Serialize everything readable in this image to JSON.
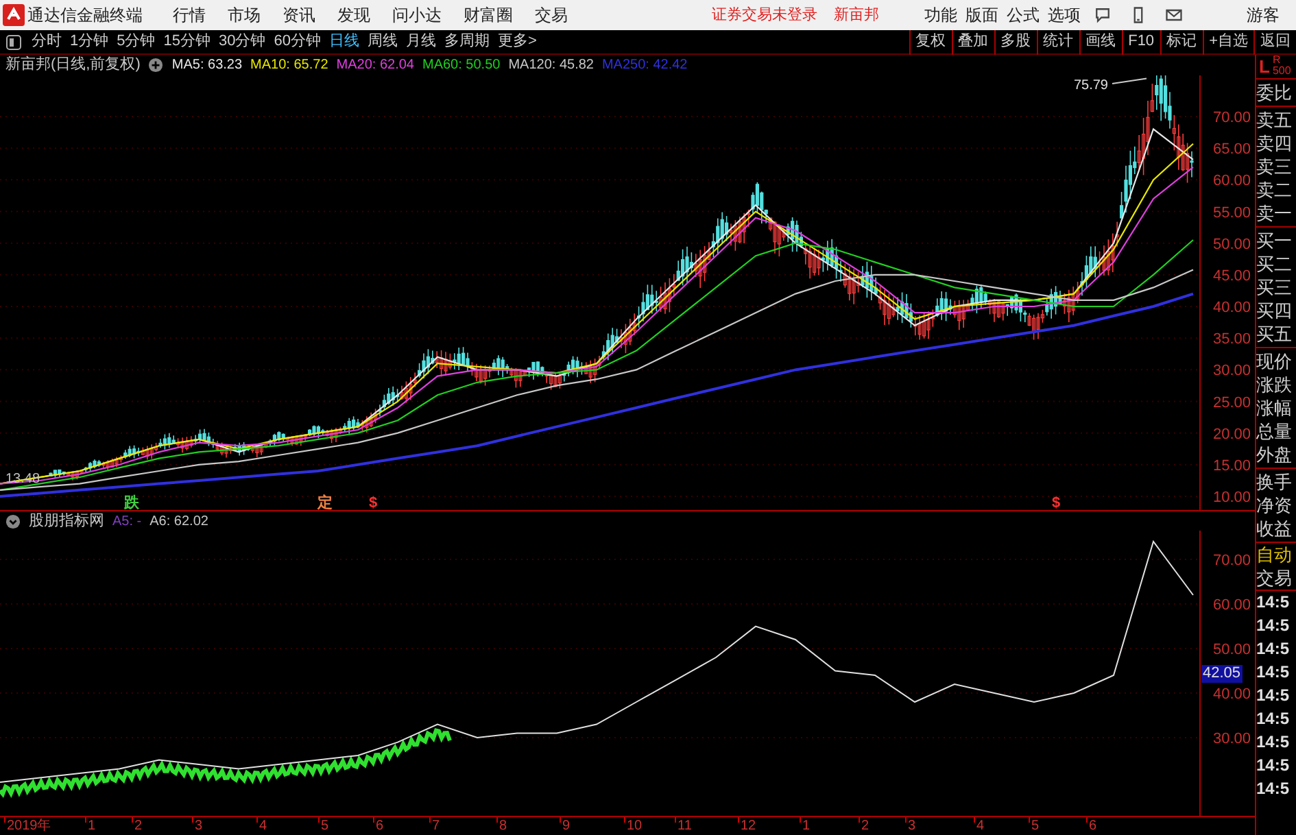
{
  "menubar": {
    "app_title": "通达信金融终端",
    "items": [
      "行情",
      "市场",
      "资讯",
      "发现",
      "问小达",
      "财富圈",
      "交易"
    ],
    "notices": [
      "证券交易未登录",
      "新亩邦"
    ],
    "right_items": [
      "功能",
      "版面",
      "公式",
      "选项"
    ],
    "user": "游客"
  },
  "toolbar": {
    "periods": [
      {
        "label": "分时",
        "selected": false
      },
      {
        "label": "1分钟",
        "selected": false
      },
      {
        "label": "5分钟",
        "selected": false
      },
      {
        "label": "15分钟",
        "selected": false
      },
      {
        "label": "30分钟",
        "selected": false
      },
      {
        "label": "60分钟",
        "selected": false
      },
      {
        "label": "日线",
        "selected": true
      },
      {
        "label": "周线",
        "selected": false
      },
      {
        "label": "月线",
        "selected": false
      },
      {
        "label": "多周期",
        "selected": false
      },
      {
        "label": "更多>",
        "selected": false
      }
    ],
    "buttons": [
      "复权",
      "叠加",
      "多股",
      "统计",
      "画线",
      "F10",
      "标记",
      "+自选",
      "返回"
    ]
  },
  "main_chart": {
    "title": "新亩邦(日线,前复权)",
    "indicators": [
      {
        "label": "MA5: 63.23",
        "color": "#e8e8e8"
      },
      {
        "label": "MA10: 65.72",
        "color": "#e8e800"
      },
      {
        "label": "MA20: 62.04",
        "color": "#e040e0"
      },
      {
        "label": "MA60: 50.50",
        "color": "#20d020"
      },
      {
        "label": "MA120: 45.82",
        "color": "#c8c8c8"
      },
      {
        "label": "MA250: 42.42",
        "color": "#3030e0"
      }
    ],
    "high_label": "75.79",
    "low_label": "13.48",
    "price_axis": [
      "70.00",
      "65.00",
      "60.00",
      "55.00",
      "50.00",
      "45.00",
      "40.00",
      "35.00",
      "30.00",
      "25.00",
      "20.00",
      "15.00",
      "10.00"
    ],
    "marks": [
      {
        "text": "跌",
        "color": "#40d040"
      },
      {
        "text": "定",
        "color": "#f08040"
      },
      {
        "text": "$",
        "color": "#ff3030"
      },
      {
        "text": "$",
        "color": "#ff3030"
      }
    ]
  },
  "lower_chart": {
    "title": "股朋指标网",
    "indicators": [
      {
        "label": "A5: -",
        "color": "#8040c0"
      },
      {
        "label": "A6: 62.02",
        "color": "#c8c8c8"
      }
    ],
    "current_value": "42.05",
    "value_axis": [
      "70.00",
      "60.00",
      "50.00",
      "40.00",
      "30.00"
    ]
  },
  "time_axis": [
    "2019年",
    "1",
    "2",
    "3",
    "4",
    "5",
    "6",
    "7",
    "8",
    "9",
    "10",
    "11",
    "12",
    "1",
    "2",
    "3",
    "4",
    "5",
    "6"
  ],
  "side_panel": {
    "header": "L",
    "header_sub": [
      "R",
      "500"
    ],
    "groups": [
      [
        "委比"
      ],
      [
        "卖五",
        "卖四",
        "卖三",
        "卖二",
        "卖一"
      ],
      [
        "买一",
        "买二",
        "买三",
        "买四",
        "买五"
      ],
      [
        "现价",
        "涨跌",
        "涨幅",
        "总量",
        "外盘"
      ],
      [
        "换手",
        "净资",
        "收益"
      ]
    ],
    "mode": "自动",
    "trade_label": "交易",
    "times": [
      "14:5",
      "14:5",
      "14:5",
      "14:5",
      "14:5",
      "14:5",
      "14:5",
      "14:5",
      "14:5"
    ]
  }
}
